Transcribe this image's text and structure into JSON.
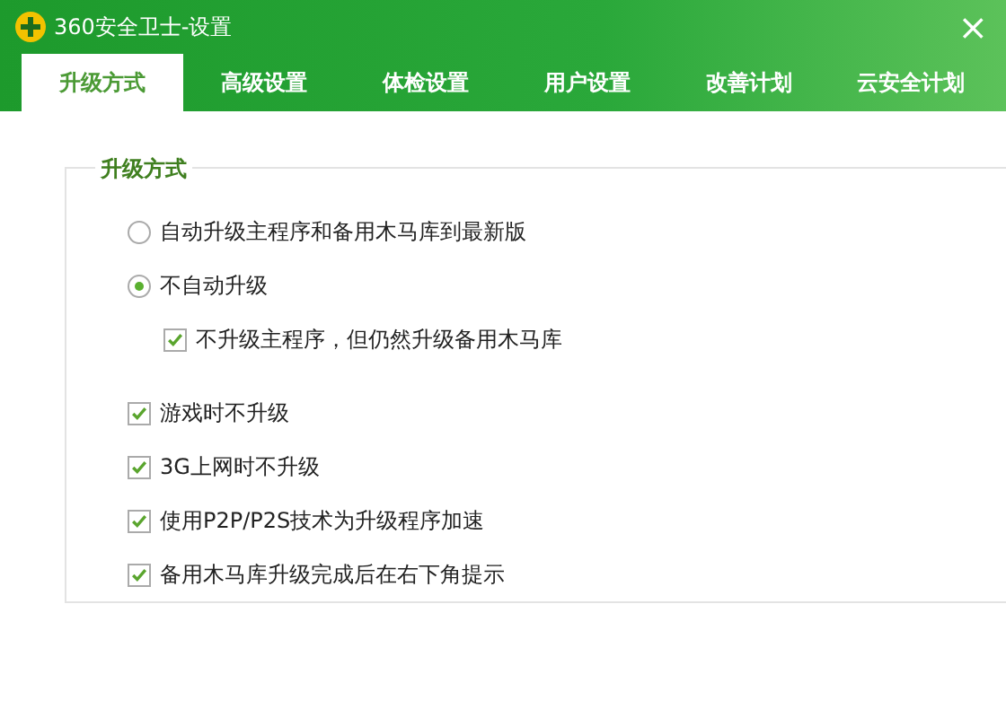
{
  "window": {
    "title": "360安全卫士-设置",
    "close": "×"
  },
  "tabs": [
    {
      "label": "升级方式",
      "selected": true
    },
    {
      "label": "高级设置",
      "selected": false
    },
    {
      "label": "体检设置",
      "selected": false
    },
    {
      "label": "用户设置",
      "selected": false
    },
    {
      "label": "改善计划",
      "selected": false
    },
    {
      "label": "云安全计划",
      "selected": false
    }
  ],
  "group": {
    "title": "升级方式",
    "options": [
      {
        "kind": "radio",
        "label": "自动升级主程序和备用木马库到最新版",
        "selected": false
      },
      {
        "kind": "radio",
        "label": "不自动升级",
        "selected": true,
        "children": [
          {
            "kind": "checkbox",
            "label": "不升级主程序，但仍然升级备用木马库",
            "checked": true
          }
        ]
      }
    ],
    "checkboxes": [
      {
        "kind": "checkbox",
        "label": "游戏时不升级",
        "checked": true
      },
      {
        "kind": "checkbox",
        "label": "3G上网时不升级",
        "checked": true
      },
      {
        "kind": "checkbox",
        "label": "使用P2P/P2S技术为升级程序加速",
        "checked": true
      },
      {
        "kind": "checkbox",
        "label": "备用木马库升级完成后在右下角提示",
        "checked": true
      }
    ]
  }
}
